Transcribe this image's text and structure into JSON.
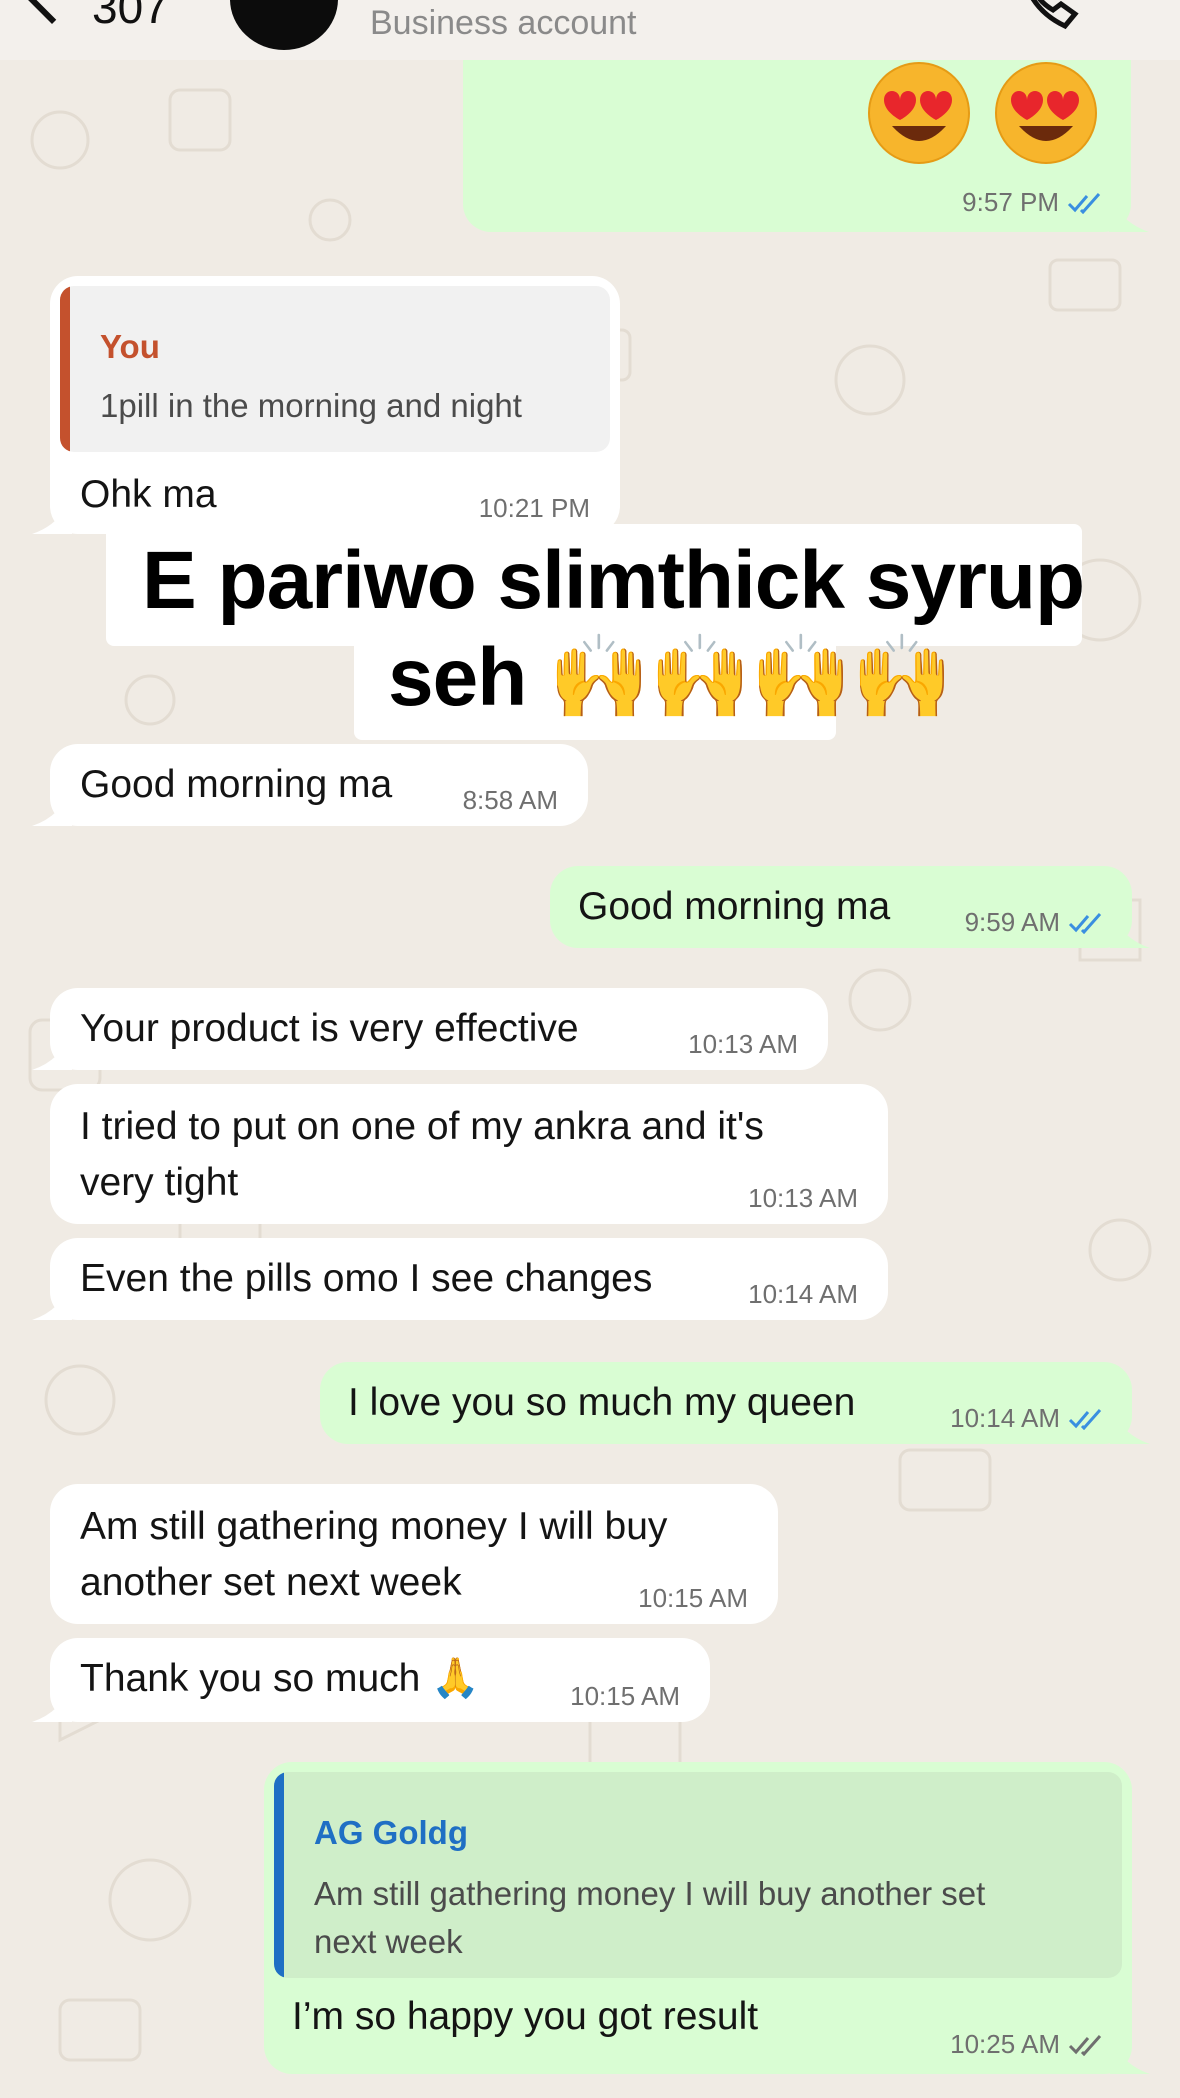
{
  "header": {
    "unread_count": "307",
    "subtitle": "Business account"
  },
  "overlay": {
    "line1": "E pariwo slimthick syrup",
    "line2": "seh 🙌🙌🙌🙌"
  },
  "messages": [
    {
      "dir": "out",
      "text": "😍 😍",
      "time": "9:57 PM",
      "ticks": "read"
    },
    {
      "dir": "in",
      "quote_author": "You",
      "quote_text": "1pill in the morning and night",
      "text": "Ohk ma",
      "time": "10:21 PM"
    },
    {
      "dir": "in",
      "text": "Good morning ma",
      "time": "8:58 AM"
    },
    {
      "dir": "out",
      "text": "Good morning ma",
      "time": "9:59 AM",
      "ticks": "read"
    },
    {
      "dir": "in",
      "text": "Your product is very effective",
      "time": "10:13 AM"
    },
    {
      "dir": "in",
      "text_lines": [
        "I tried to put on one of my ankra and it's",
        "very tight"
      ],
      "time": "10:13 AM"
    },
    {
      "dir": "in",
      "text": "Even the pills omo I see changes",
      "time": "10:14 AM"
    },
    {
      "dir": "out",
      "text": "I love you so much my queen",
      "time": "10:14 AM",
      "ticks": "read"
    },
    {
      "dir": "in",
      "text_lines": [
        "Am still gathering money I will buy",
        "another set next week"
      ],
      "time": "10:15 AM"
    },
    {
      "dir": "in",
      "text": "Thank you so much 🙏",
      "time": "10:15 AM"
    },
    {
      "dir": "out",
      "quote_author": "AG Goldg",
      "quote_lines": [
        "Am still gathering money I will buy another set",
        "next week"
      ],
      "text": "I’m so happy you got result",
      "time": "10:25 AM",
      "ticks": "delivered"
    }
  ],
  "colors": {
    "chat_background": "#f0ebe4",
    "incoming_bubble": "#ffffff",
    "outgoing_bubble": "#d9fdd3",
    "read_ticks": "#3a8fe0",
    "delivered_ticks": "#6f6f6f",
    "quote_you_accent": "#c4512d",
    "quote_contact_accent": "#1f6fc4"
  },
  "icons": [
    "back-chevron-icon",
    "avatar",
    "phone-icon",
    "double-check-icon",
    "smiling-face-with-heart-eyes-emoji",
    "folded-hands-emoji",
    "raising-hands-emoji"
  ]
}
